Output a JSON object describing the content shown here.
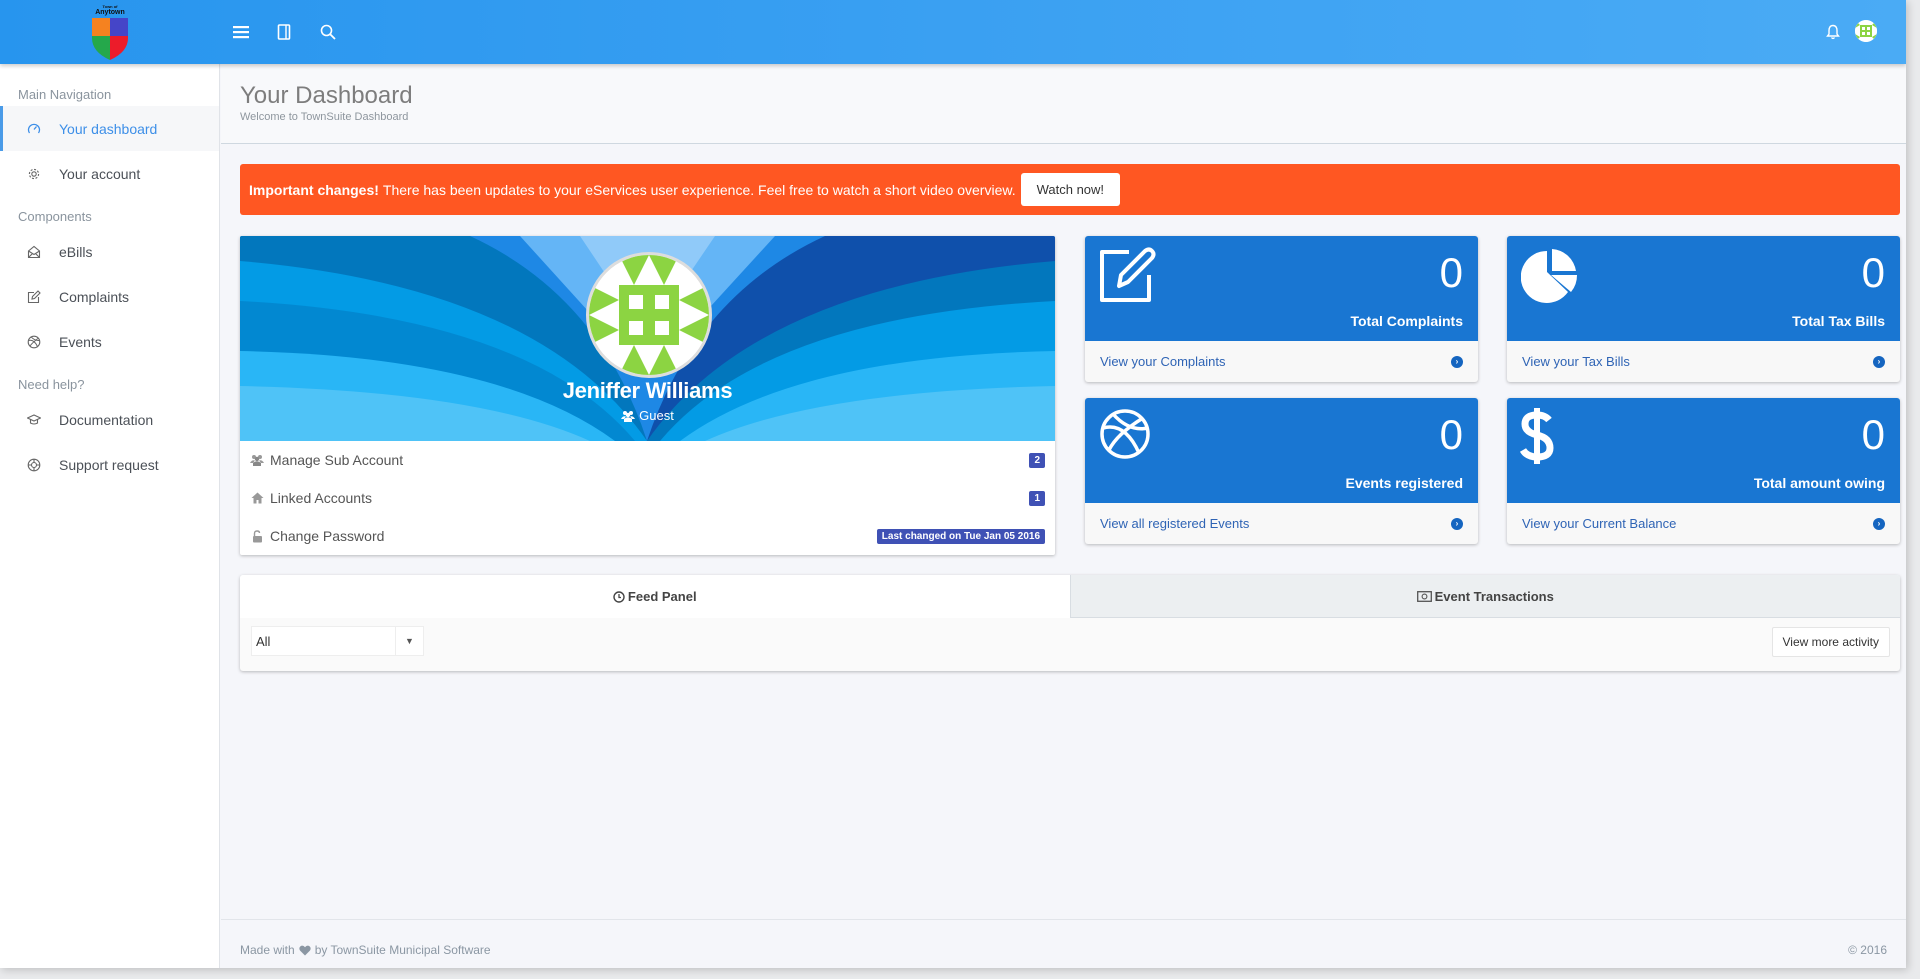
{
  "header": {
    "logo": {
      "town_prefix": "Town of",
      "town_name": "Anytown"
    },
    "icons": [
      "menu-icon",
      "notebook-icon",
      "search-icon",
      "bell-icon",
      "user-avatar"
    ]
  },
  "sidebar": {
    "sections": [
      {
        "heading": "Main Navigation",
        "items": [
          {
            "label": "Your dashboard",
            "icon": "dashboard-icon",
            "active": true
          },
          {
            "label": "Your account",
            "icon": "gear-icon",
            "active": false
          }
        ]
      },
      {
        "heading": "Components",
        "items": [
          {
            "label": "eBills",
            "icon": "envelope-open-icon",
            "active": false
          },
          {
            "label": "Complaints",
            "icon": "edit-icon",
            "active": false
          },
          {
            "label": "Events",
            "icon": "basketball-icon",
            "active": false
          }
        ]
      },
      {
        "heading": "Need help?",
        "items": [
          {
            "label": "Documentation",
            "icon": "graduation-cap-icon",
            "active": false
          },
          {
            "label": "Support request",
            "icon": "lifebuoy-icon",
            "active": false
          }
        ]
      }
    ]
  },
  "page": {
    "title": "Your Dashboard",
    "subtitle": "Welcome to TownSuite Dashboard"
  },
  "alert": {
    "strong": "Important changes!",
    "message": "There has been updates to your eServices user experience. Feel free to watch a short video overview.",
    "button": "Watch now!",
    "color": "#ff5722"
  },
  "profile": {
    "name": "Jeniffer Williams",
    "role": "Guest",
    "rows": [
      {
        "label": "Manage Sub Account",
        "icon": "users-icon",
        "badge": "2"
      },
      {
        "label": "Linked Accounts",
        "icon": "home-icon",
        "badge": "1"
      },
      {
        "label": "Change Password",
        "icon": "unlock-icon",
        "badge": "Last changed on Tue Jan 05 2016"
      }
    ]
  },
  "stats": [
    {
      "value": "0",
      "label": "Total Complaints",
      "link": "View your Complaints",
      "icon": "edit-icon"
    },
    {
      "value": "0",
      "label": "Total Tax Bills",
      "link": "View your Tax Bills",
      "icon": "pie-chart-icon"
    },
    {
      "value": "0",
      "label": "Events registered",
      "link": "View all registered Events",
      "icon": "basketball-icon"
    },
    {
      "value": "0",
      "label": "Total amount owing",
      "link": "View your Current Balance",
      "icon": "dollar-icon"
    }
  ],
  "stat_color": "#1976d2",
  "feed": {
    "tabs": [
      {
        "label": "Feed Panel",
        "icon": "clock-icon",
        "active": true
      },
      {
        "label": "Event Transactions",
        "icon": "money-icon",
        "active": false
      }
    ],
    "filter": {
      "value": "All"
    },
    "more_button": "View more activity"
  },
  "footer": {
    "made_with": "Made with",
    "by": "by TownSuite Municipal Software",
    "copyright": "© 2016"
  }
}
